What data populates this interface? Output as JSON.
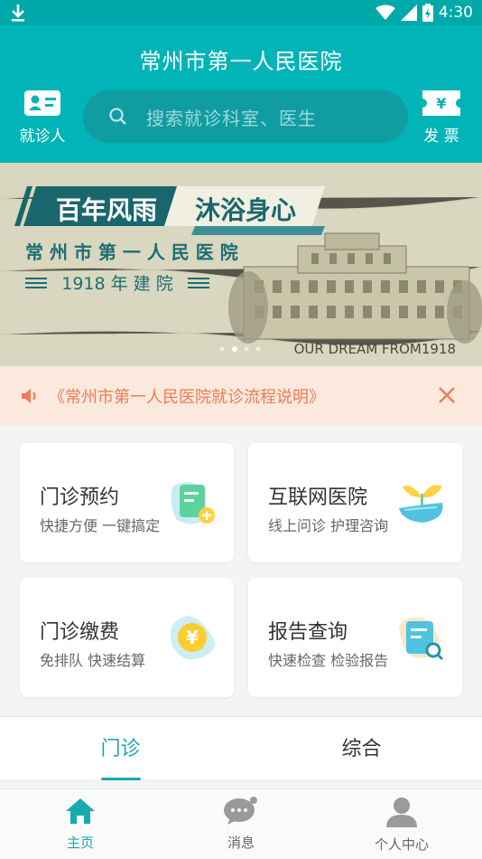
{
  "status_bar": {
    "time": "4:30"
  },
  "header": {
    "title": "常州市第一人民医院",
    "left_button_label": "就诊人",
    "right_button_label": "发 票",
    "search_placeholder": "搜索就诊科室、医生"
  },
  "banner": {
    "slogan_left": "百年风雨",
    "slogan_right": "沐浴身心",
    "hospital_name": "常 州 市 第 一 人 民 医 院",
    "founded": "1918 年 建 院",
    "dream": "OUR DREAM FROM1918",
    "indicator_count": 4,
    "indicator_active": 1
  },
  "notice": {
    "text": "《常州市第一人民医院就诊流程说明》"
  },
  "cards": [
    {
      "title": "门诊预约",
      "subtitle": "快捷方便 一键搞定",
      "icon": "appointment-icon"
    },
    {
      "title": "互联网医院",
      "subtitle": "线上问诊 护理咨询",
      "icon": "internet-hospital-icon"
    },
    {
      "title": "门诊缴费",
      "subtitle": "免排队 快速结算",
      "icon": "yuan-payment-icon"
    },
    {
      "title": "报告查询",
      "subtitle": "快速检查 检验报告",
      "icon": "report-search-icon"
    }
  ],
  "tabs": [
    {
      "label": "门诊",
      "active": true
    },
    {
      "label": "综合",
      "active": false
    }
  ],
  "bottom_nav": [
    {
      "label": "主页",
      "icon": "home-icon",
      "active": true
    },
    {
      "label": "消息",
      "icon": "message-icon",
      "active": false
    },
    {
      "label": "个人中心",
      "icon": "user-icon",
      "active": false
    }
  ],
  "colors": {
    "accent": "#00b4b7",
    "notice_text": "#ee7b55",
    "notice_bg": "#fae9dc"
  }
}
